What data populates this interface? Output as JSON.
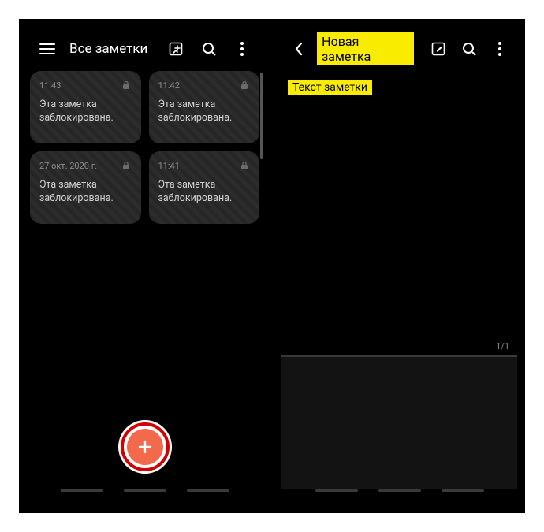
{
  "notes_list": {
    "title": "Все заметки",
    "notes": [
      {
        "time": "11:43",
        "text": "Эта заметка заблокирована.",
        "locked": true
      },
      {
        "time": "11:42",
        "text": "Эта заметка заблокирована.",
        "locked": true
      },
      {
        "time": "27 окт. 2020 г.",
        "text": "Эта заметка заблокирована.",
        "locked": true
      },
      {
        "time": "11:41",
        "text": "Эта заметка заблокирована.",
        "locked": true
      }
    ],
    "fab_highlight_color": "#d40000",
    "fab_color": "#f26a4b"
  },
  "editor": {
    "title": "Новая заметка",
    "body_placeholder": "Текст заметки",
    "page_counter": "1/1",
    "highlight_color": "#f9ec00"
  }
}
